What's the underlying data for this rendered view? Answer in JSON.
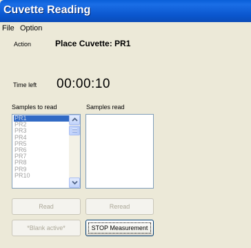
{
  "window": {
    "title": "Cuvette Reading"
  },
  "menu": {
    "items": [
      "File",
      "Option"
    ]
  },
  "action": {
    "label": "Action",
    "value": "Place Cuvette: PR1"
  },
  "time": {
    "label": "Time left",
    "value": "00:00:10"
  },
  "samples_to_read": {
    "label": "Samples to read",
    "items": [
      "PR1",
      "PR2",
      "PR3",
      "PR4",
      "PR5",
      "PR6",
      "PR7",
      "PR8",
      "PR9",
      "PR10"
    ],
    "selected_index": 0
  },
  "samples_read": {
    "label": "Samples read",
    "items": []
  },
  "buttons": {
    "read": "Read",
    "reread": "Reread",
    "blank": "*Blank active*",
    "stop": "STOP Measurement"
  }
}
